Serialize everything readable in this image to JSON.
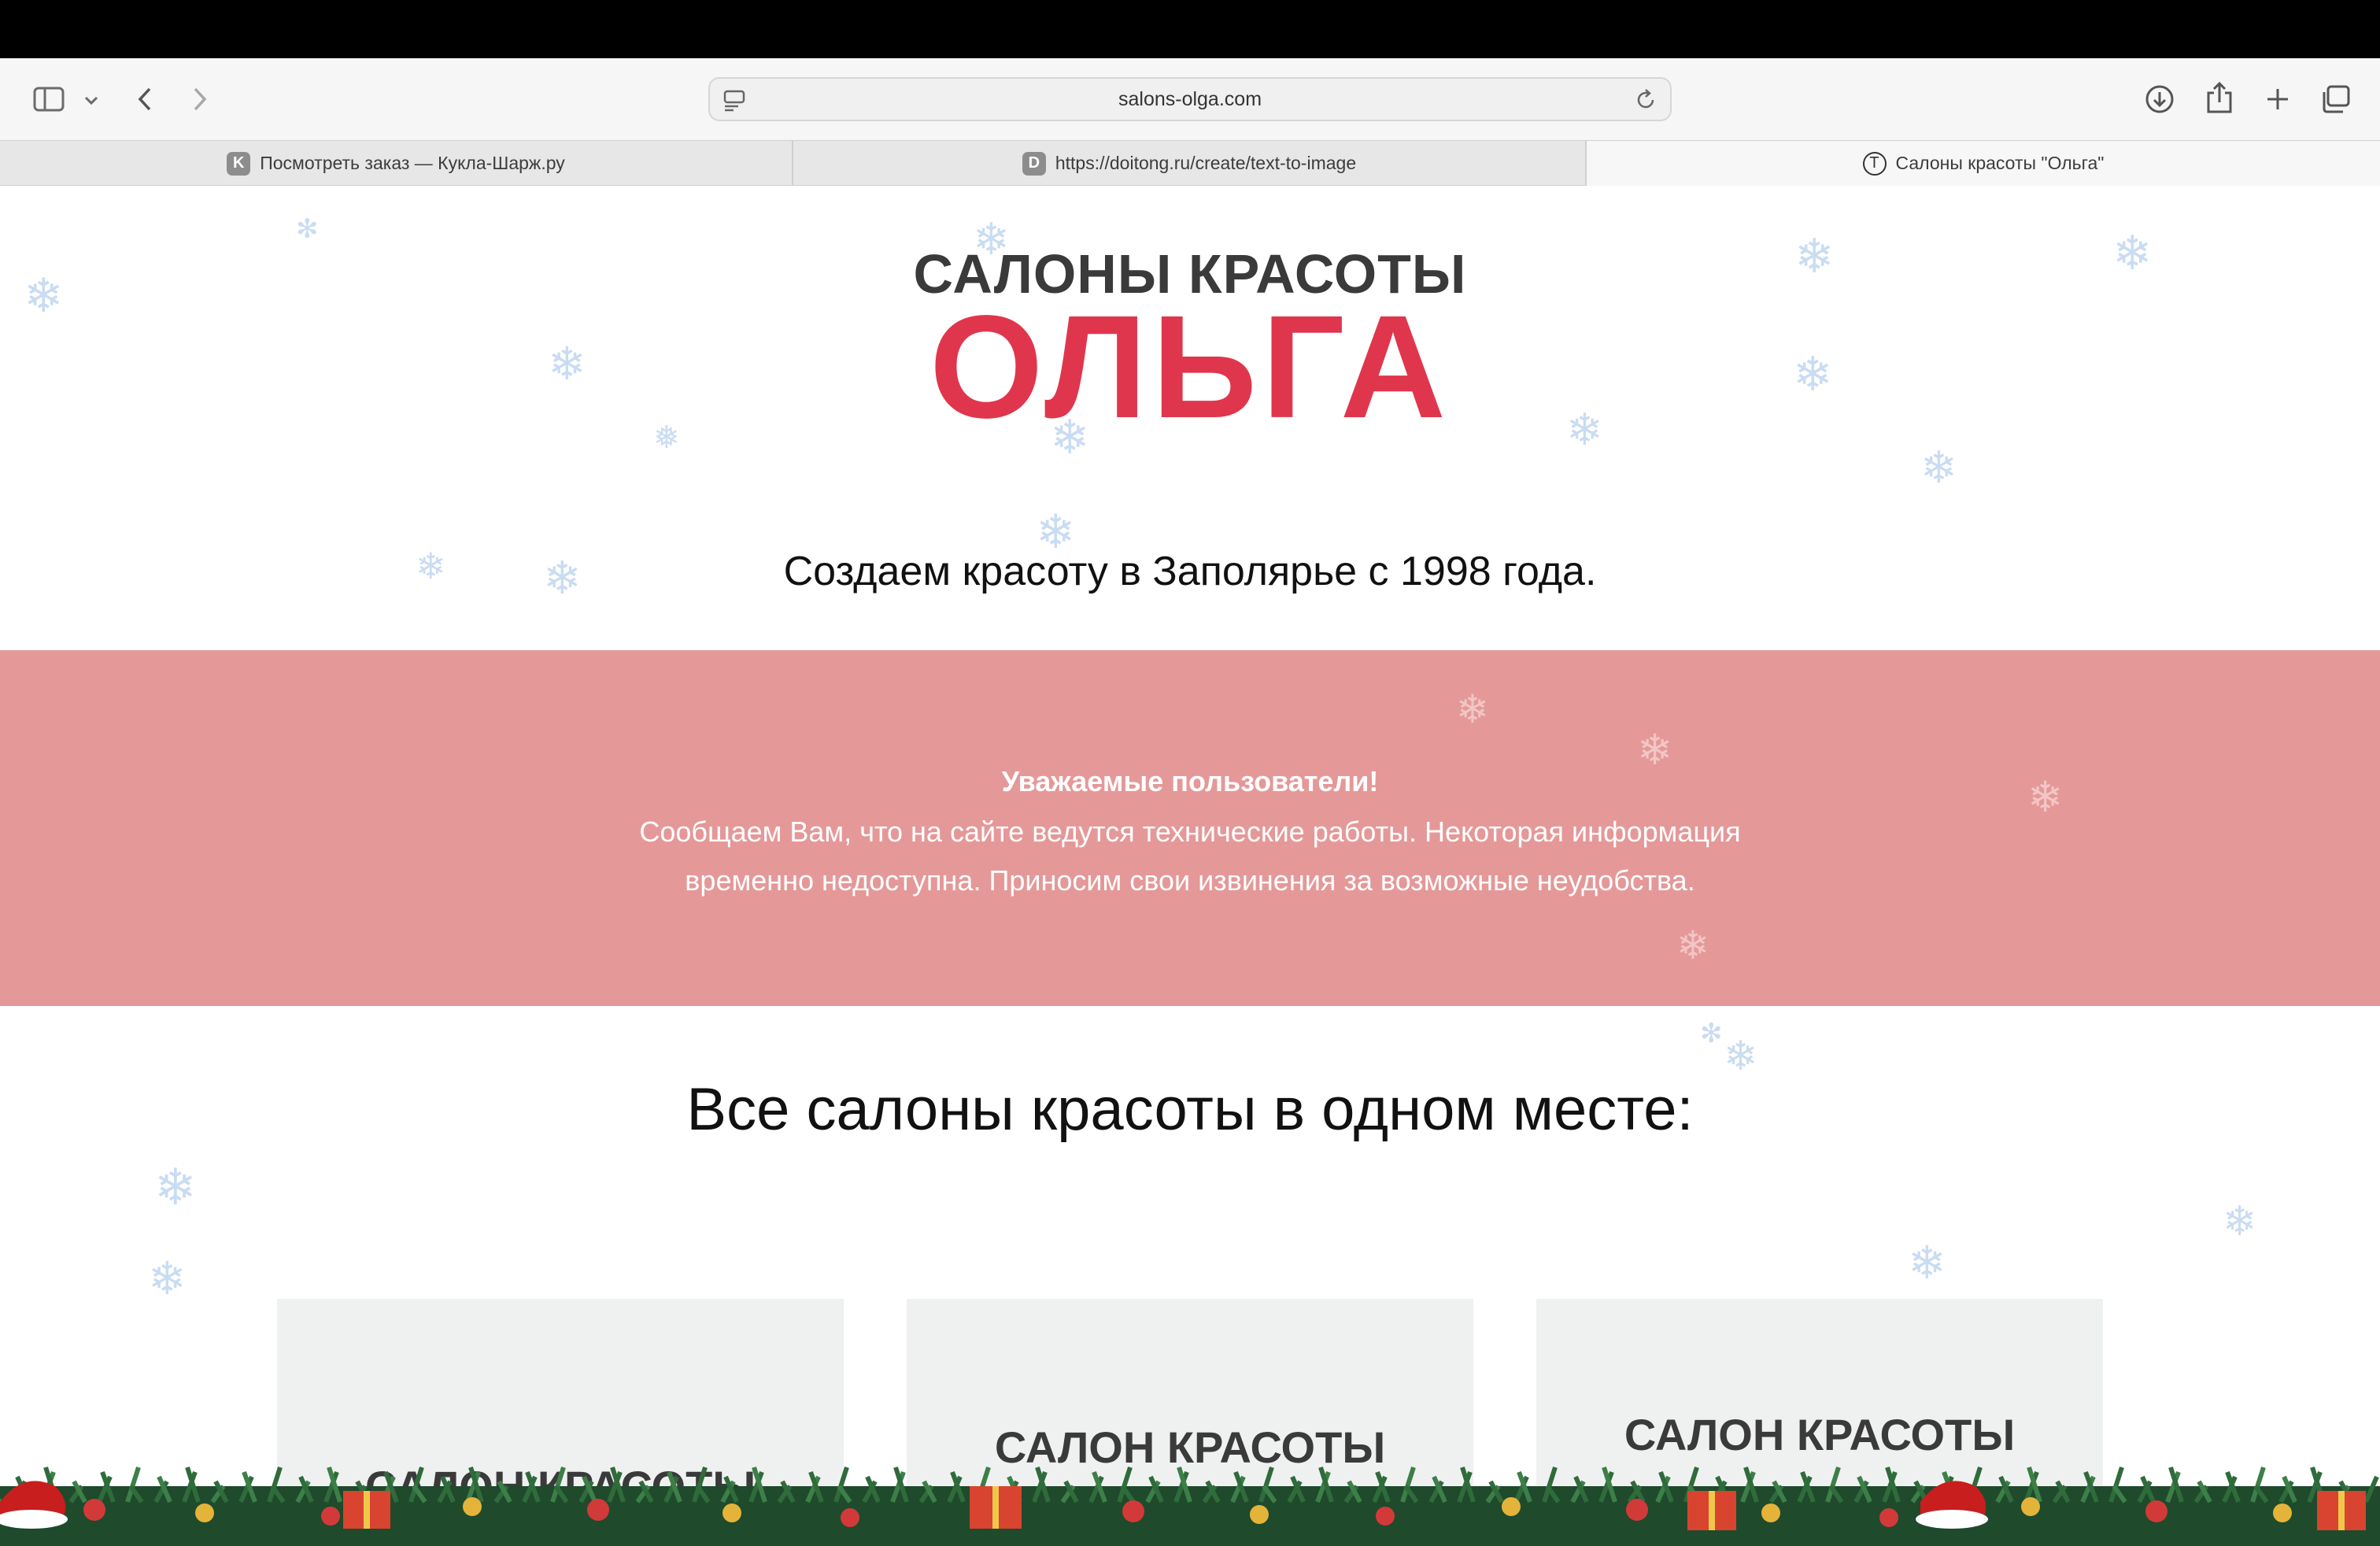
{
  "browser": {
    "url": "salons-olga.com",
    "tabs": [
      {
        "icon_letter": "K",
        "title": "Посмотреть заказ — Кукла-Шарж.ру"
      },
      {
        "icon_letter": "D",
        "title": "https://doitong.ru/create/text-to-image"
      },
      {
        "icon_letter": "T",
        "title": "Салоны красоты \"Ольга\""
      }
    ]
  },
  "header": {
    "logo_top": "САЛОНЫ КРАСОТЫ",
    "logo_main": "ОЛЬГА",
    "tagline": "Создаем красоту в Заполярье с 1998 года."
  },
  "notice": {
    "title": "Уважаемые пользователи!",
    "text": "Сообщаем Вам, что на сайте ведутся технические работы. Некоторая информация временно недоступна. Приносим свои извинения за возможные неудобства."
  },
  "salons": {
    "title": "Все салоны красоты в одном месте:",
    "cards": [
      {
        "label": "САЛОН КРАСОТЫ"
      },
      {
        "label": "САЛОН КРАСОТЫ"
      },
      {
        "label": "САЛОН КРАСОТЫ"
      }
    ]
  },
  "colors": {
    "brand_red": "#e0364d",
    "notice_bg": "#e59898",
    "card_bg": "#eff1f1"
  }
}
